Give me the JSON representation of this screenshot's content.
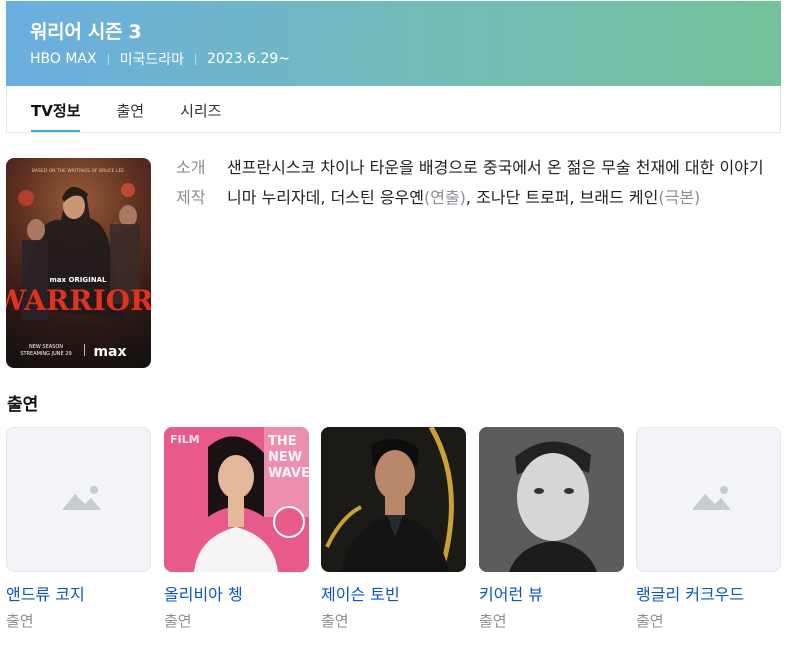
{
  "header": {
    "title": "워리어 시즌 3",
    "meta": [
      "HBO MAX",
      "미국드라마",
      "2023.6.29~"
    ]
  },
  "tabs": [
    "TV정보",
    "출연",
    "시리즈"
  ],
  "info": {
    "synopsis_label": "소개",
    "synopsis": "샌프란시스코 차이나 타운을 배경으로 중국에서 온 젊은 무술 천재에 대한 이야기",
    "production_label": "제작",
    "production_people": "니마 누리자데, 더스틴 응우옌",
    "production_role_1": "(연출)",
    "production_people_2": ", 조나단 트로퍼, 브래드 케인",
    "production_role_2": "(극본)"
  },
  "poster": {
    "tagline_top": "BASED ON THE WRITINGS OF BRUCE LEE",
    "brand": "max ORIGINAL",
    "title": "WARRIOR",
    "new_season": "NEW SEASON",
    "streaming": "STREAMING JUNE 29",
    "logo": "max"
  },
  "cast_heading": "출연",
  "cast": [
    {
      "name": "앤드류 코지",
      "role": "출연",
      "photo": "placeholder-image-icon"
    },
    {
      "name": "올리비아 쳉",
      "role": "출연",
      "photo": "portrait"
    },
    {
      "name": "제이슨 토빈",
      "role": "출연",
      "photo": "portrait"
    },
    {
      "name": "키어런 뷰",
      "role": "출연",
      "photo": "portrait"
    },
    {
      "name": "랭글리 커크우드",
      "role": "출연",
      "photo": "placeholder-image-icon"
    }
  ],
  "colors": {
    "header_gradient_start": "#6aaee0",
    "header_gradient_end": "#74c29a",
    "link": "#0a56c2",
    "tab_underline": "#45a8d4",
    "muted": "#8a8f96"
  }
}
